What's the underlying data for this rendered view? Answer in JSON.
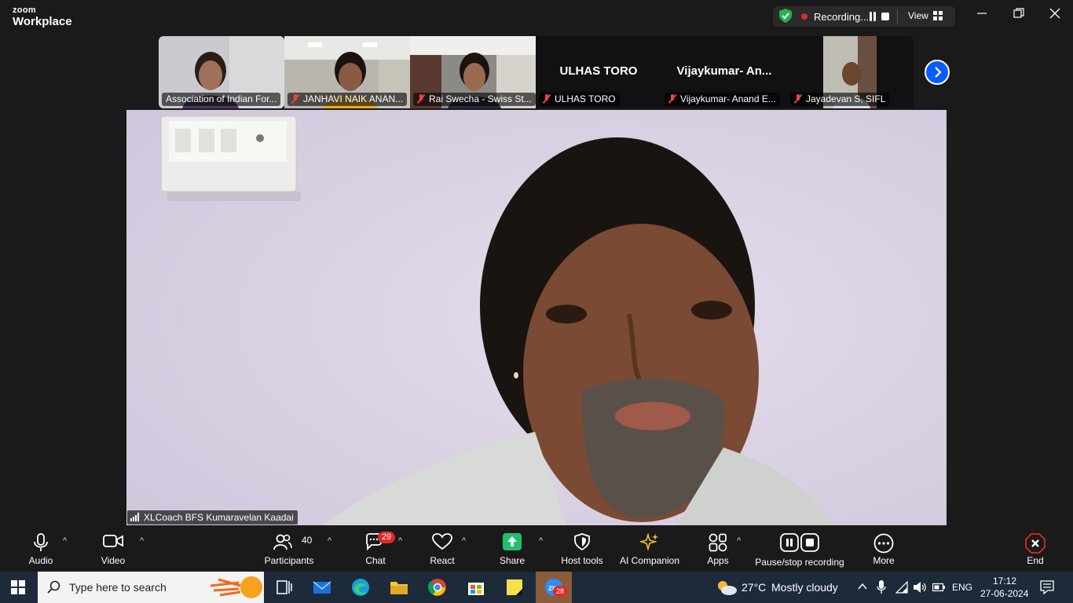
{
  "app": {
    "brand_top": "zoom",
    "brand_bottom": "Workplace"
  },
  "recording": {
    "status": "Recording...",
    "view_label": "View"
  },
  "filmstrip": [
    {
      "name": "Association of Indian For...",
      "muted": false,
      "video": true,
      "active": true
    },
    {
      "name": "JANHAVI NAIK ANAN...",
      "muted": true,
      "video": true,
      "active": false
    },
    {
      "name": "Rai Swecha - Swiss St...",
      "muted": true,
      "video": true,
      "active": false
    },
    {
      "name": "ULHAS TORO",
      "big_name": "ULHAS TORO",
      "muted": true,
      "video": false,
      "active": false
    },
    {
      "name": "Vijaykumar- Anand E...",
      "big_name": "Vijaykumar-  An...",
      "muted": true,
      "video": false,
      "active": false
    },
    {
      "name": "Jayadevan S,  SIFL",
      "muted": true,
      "video": true,
      "active": false
    }
  ],
  "speaker": {
    "name": "XLCoach BFS Kumaravelan Kaadai"
  },
  "toolbar": {
    "audio": "Audio",
    "video": "Video",
    "participants": "Participants",
    "participants_count": "40",
    "chat": "Chat",
    "chat_badge": "29",
    "react": "React",
    "share": "Share",
    "host_tools": "Host tools",
    "ai_companion": "AI Companion",
    "apps": "Apps",
    "pause_stop": "Pause/stop recording",
    "more": "More",
    "end": "End"
  },
  "taskbar": {
    "search_placeholder": "Type here to search",
    "zoom_badge": "28",
    "weather_temp": "27°C",
    "weather_text": "Mostly cloudy",
    "lang": "ENG",
    "time": "17:12",
    "date": "27-06-2024"
  },
  "colors": {
    "accent": "#0b5cff",
    "share_green": "#1fc16b",
    "end_red": "#e02828",
    "active_border": "#3bd67b"
  }
}
